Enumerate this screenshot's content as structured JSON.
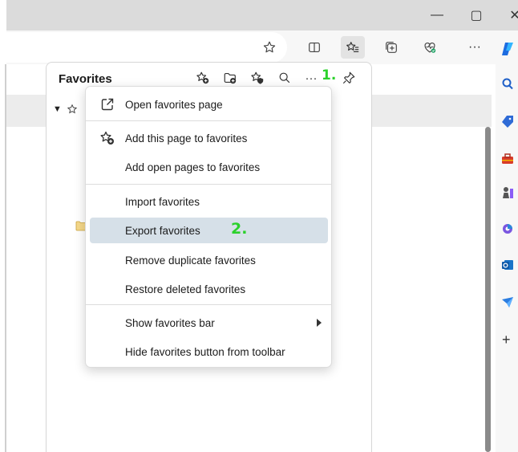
{
  "window": {
    "minimize_glyph": "—",
    "maximize_glyph": "▢",
    "close_glyph": "✕"
  },
  "toolbar": {
    "more_glyph": "···",
    "icons": [
      "star-outline-icon",
      "split-screen-icon",
      "favorites-icon",
      "collections-icon",
      "browser-essentials-icon",
      "more-icon"
    ]
  },
  "favorites": {
    "title": "Favorites",
    "header_more_glyph": "···",
    "tree_toggle_glyph": "▼",
    "annotation_1": "1.",
    "annotation_2": "2."
  },
  "menu": {
    "items": [
      {
        "label": "Open favorites page",
        "icon": "open-external-icon"
      },
      {
        "label": "Add this page to favorites",
        "icon": "add-favorite-icon"
      },
      {
        "label": "Add open pages to favorites"
      },
      {
        "label": "Import favorites"
      },
      {
        "label": "Export favorites",
        "highlighted": true
      },
      {
        "label": "Remove duplicate favorites"
      },
      {
        "label": "Restore deleted favorites"
      },
      {
        "label": "Show favorites bar",
        "has_submenu": true
      },
      {
        "label": "Hide favorites button from toolbar"
      }
    ]
  },
  "sidebar": {
    "add_glyph": "+"
  },
  "colors": {
    "accent": "#0f6cbd",
    "annotation": "#2bd12b",
    "highlight": "#d6e0e8"
  }
}
